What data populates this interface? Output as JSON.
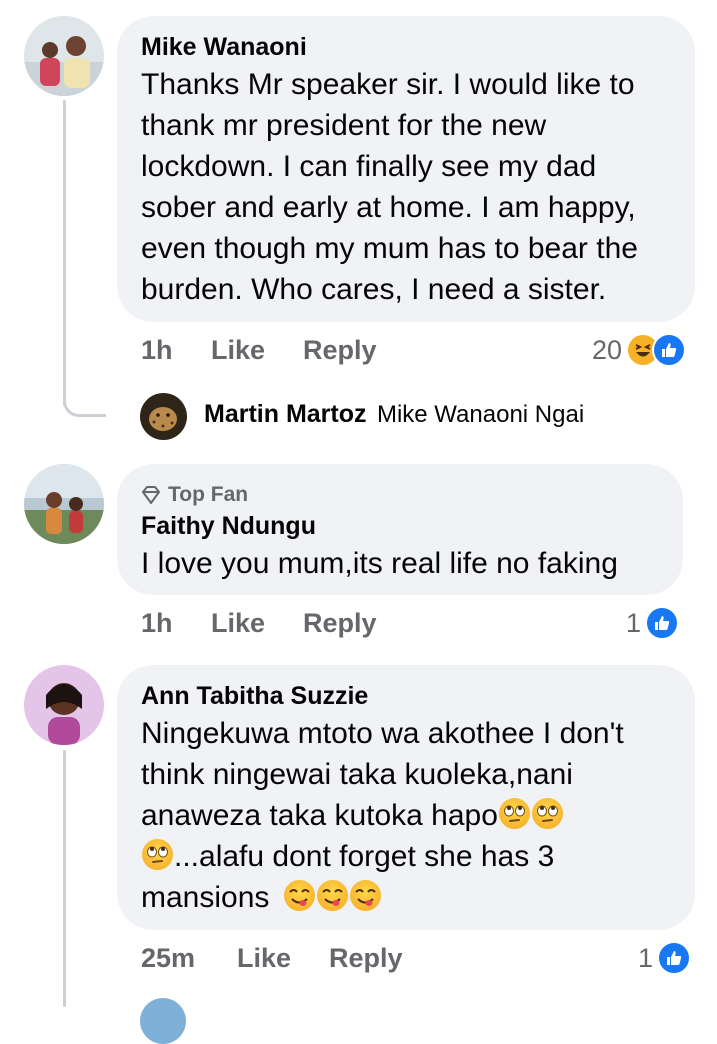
{
  "comments": [
    {
      "author": "Mike Wanaoni",
      "lines": [
        "Thanks Mr speaker sir. I would like to",
        "thank mr president for the new",
        "lockdown. I can finally see my dad",
        "sober and early at home. I am happy,",
        "even though my mum has to bear the",
        "burden. Who cares, I need a sister."
      ],
      "time": "1h",
      "like_label": "Like",
      "reply_label": "Reply",
      "reaction_count": "20",
      "reactions": [
        "haha-icon",
        "like-icon"
      ]
    },
    {
      "badge": "Top Fan",
      "author": "Faithy Ndungu",
      "lines": [
        "I love you mum,its real life no faking"
      ],
      "time": "1h",
      "like_label": "Like",
      "reply_label": "Reply",
      "reaction_count": "1",
      "reactions": [
        "like-icon"
      ]
    },
    {
      "author": "Ann Tabitha Suzzie",
      "lines": [
        "Ningekuwa mtoto wa akothee I don't",
        "think ningewai taka kuoleka,nani",
        "anaweza taka kutoka hapo",
        "...alafu dont forget she has 3",
        "mansions"
      ],
      "time": "25m",
      "like_label": "Like",
      "reply_label": "Reply",
      "reaction_count": "1",
      "reactions": [
        "like-icon"
      ]
    }
  ],
  "reply_preview": {
    "author": "Martin Martoz",
    "text": "Mike Wanaoni Ngai"
  },
  "colors": {
    "bubble": "#f0f2f5",
    "meta": "#65676b",
    "like_blue": "#1877f2",
    "haha_yellow": "#f7b125"
  }
}
